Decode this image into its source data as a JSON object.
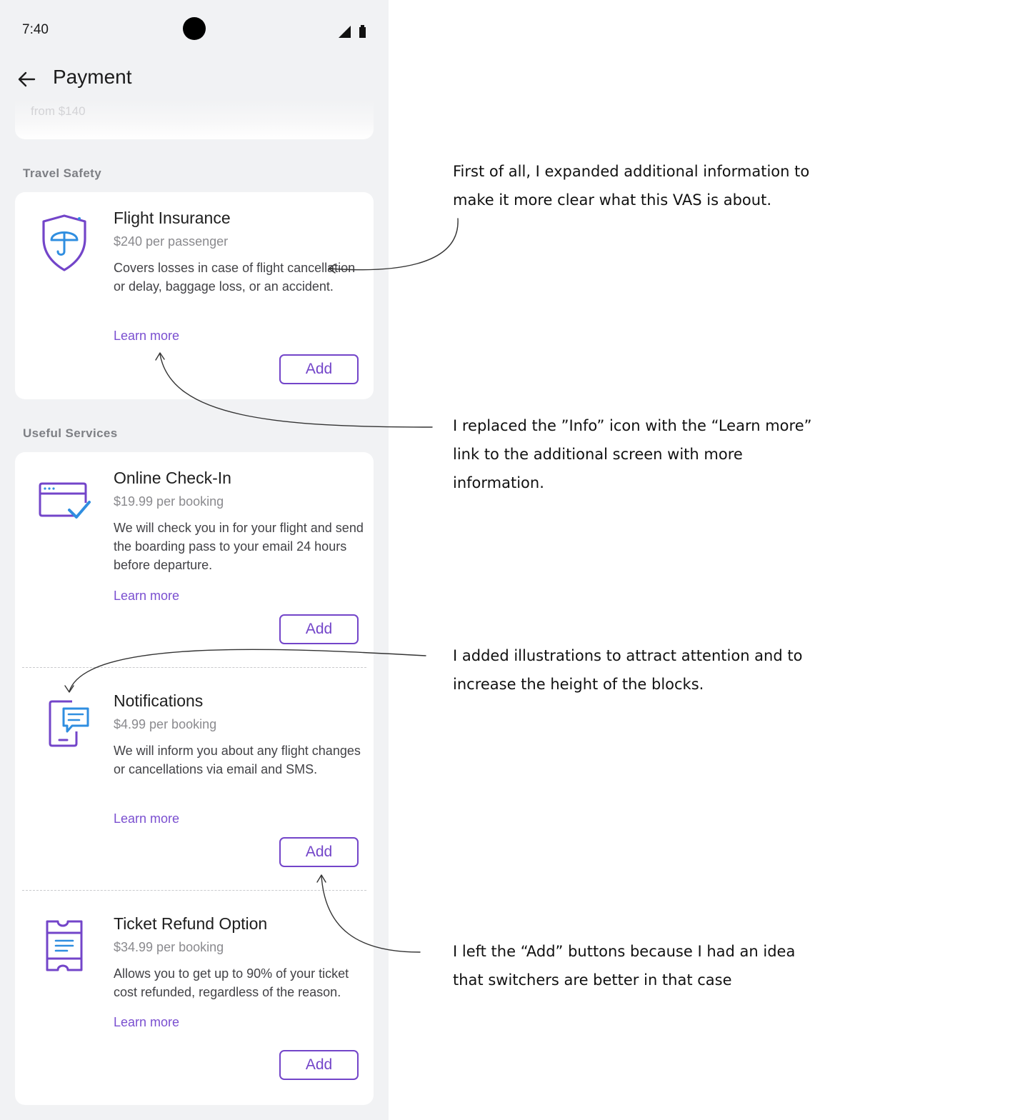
{
  "status_bar": {
    "time": "7:40"
  },
  "header": {
    "title": "Payment"
  },
  "previous_card": {
    "text": "from $140"
  },
  "sections": {
    "travel_safety": {
      "title": "Travel Safety"
    },
    "useful_services": {
      "title": "Useful Services"
    }
  },
  "items": [
    {
      "title": "Flight Insurance",
      "price": "$240 per passenger",
      "description": "Covers losses in case of flight cancellation or delay, baggage loss, or an accident.",
      "link": "Learn more",
      "button": "Add",
      "icon": "umbrella-shield-icon"
    },
    {
      "title": "Online Check-In",
      "price": "$19.99 per booking",
      "description": "We will check you in for your flight and send the boarding pass to your email 24 hours before departure.",
      "link": "Learn more",
      "button": "Add",
      "icon": "browser-check-icon"
    },
    {
      "title": "Notifications",
      "price": "$4.99 per booking",
      "description": "We will inform you about any flight changes or cancellations via email and SMS.",
      "link": "Learn more",
      "button": "Add",
      "icon": "phone-chat-icon"
    },
    {
      "title": "Ticket Refund Option",
      "price": "$34.99 per booking",
      "description": "Allows you to get up to 90% of your ticket cost refunded, regardless of the reason.",
      "link": "Learn more",
      "button": "Add",
      "icon": "ticket-icon"
    }
  ],
  "annotations": [
    "First of all, I expanded additional information to make it more clear what this VAS is about.",
    "I replaced the ”Info” icon with the “Learn more” link to the additional screen with more information.",
    "I added illustrations to attract attention and to increase the height of the blocks.",
    "I left the “Add” buttons because I had an idea that switchers are better in that case"
  ],
  "colors": {
    "accent": "#7345c9",
    "link": "#7a4fd0",
    "icon_blue": "#2f8ee0",
    "phone_background": "#f1f2f4"
  }
}
